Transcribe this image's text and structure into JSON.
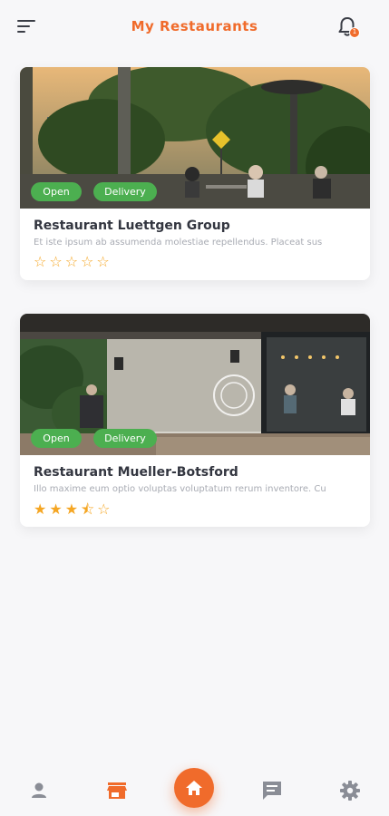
{
  "header": {
    "title": "My Restaurants",
    "menu_icon": "hamburger-menu-icon",
    "notification_icon": "bell-icon",
    "notification_badge": "1"
  },
  "restaurants": [
    {
      "name": "Restaurant Luettgen Group",
      "description": "Et iste ipsum ab assumenda molestiae repellendus. Placeat sus",
      "badges": [
        "Open",
        "Delivery"
      ],
      "rating": 0,
      "stars": "☆☆☆☆☆"
    },
    {
      "name": "Restaurant Mueller-Botsford",
      "description": "Illo maxime eum optio voluptas voluptatum rerum inventore. Cu",
      "badges": [
        "Open",
        "Delivery"
      ],
      "rating": 3.5,
      "stars": "★★★⯪☆"
    }
  ],
  "bottom_nav": {
    "items": [
      {
        "icon": "person-icon",
        "active": false
      },
      {
        "icon": "store-icon",
        "active": true
      },
      {
        "icon": "home-icon",
        "active": false
      },
      {
        "icon": "chat-icon",
        "active": false
      },
      {
        "icon": "gear-icon",
        "active": false
      }
    ]
  },
  "colors": {
    "accent": "#f06b2b",
    "badge_green": "#4caf50",
    "star": "#f5a623",
    "nav_inactive": "#8a8d96"
  }
}
